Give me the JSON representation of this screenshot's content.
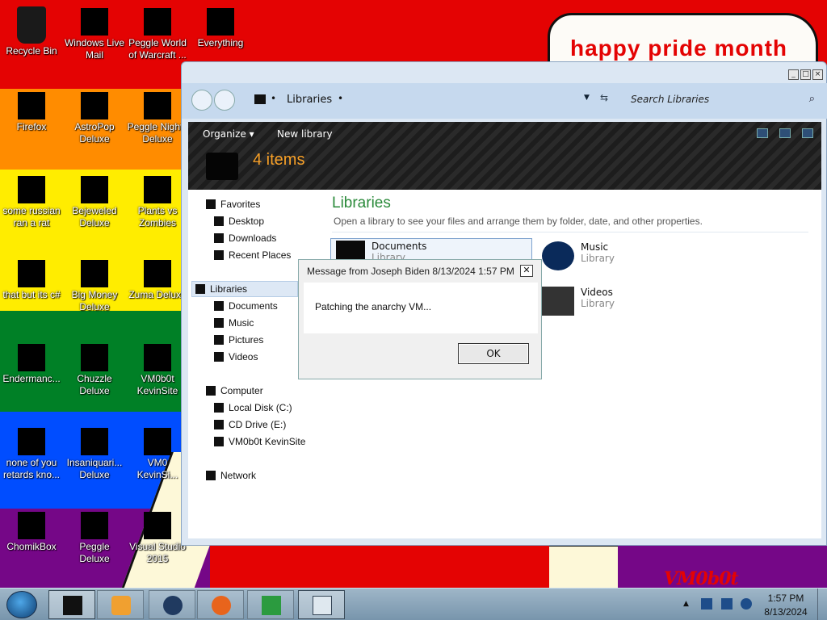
{
  "desktop": {
    "banner": "happy pride month",
    "wallpaper_logo": "VM0b0t",
    "icons": [
      {
        "label": "Recycle Bin",
        "icon": "recycle-bin-icon"
      },
      {
        "label": "Windows Live Mail",
        "icon": "mail-icon"
      },
      {
        "label": "Peggle World of Warcraft ...",
        "icon": "peggle-icon"
      },
      {
        "label": "Everything",
        "icon": "search-icon"
      },
      {
        "label": "Firefox",
        "icon": "firefox-icon"
      },
      {
        "label": "AstroPop Deluxe",
        "icon": "game-icon"
      },
      {
        "label": "Peggle Nights Deluxe",
        "icon": "peggle-icon"
      },
      {
        "label": "some russian ran a rat",
        "icon": "app-icon"
      },
      {
        "label": "Bejeweled Deluxe",
        "icon": "gem-icon"
      },
      {
        "label": "Plants vs Zombies",
        "icon": "plant-icon"
      },
      {
        "label": "that but its c#",
        "icon": "app-icon"
      },
      {
        "label": "Big Money Deluxe",
        "icon": "money-icon"
      },
      {
        "label": "Zuma Deluxe",
        "icon": "zuma-icon"
      },
      {
        "label": "Endermanc...",
        "icon": "app-icon"
      },
      {
        "label": "Chuzzle Deluxe",
        "icon": "chuzzle-icon"
      },
      {
        "label": "VM0b0t KevinSite",
        "icon": "app-icon"
      },
      {
        "label": "none of you retards kno...",
        "icon": "app-icon"
      },
      {
        "label": "Insaniquari... Deluxe",
        "icon": "fish-icon"
      },
      {
        "label": "VM0 KevinSi...",
        "icon": "app-icon"
      },
      {
        "label": "ChomikBox",
        "icon": "chomikbox-icon"
      },
      {
        "label": "Peggle Deluxe",
        "icon": "peggle-icon"
      },
      {
        "label": "Visual Studio 2015",
        "icon": "visual-studio-icon"
      }
    ]
  },
  "explorer": {
    "address": "Libraries",
    "search_placeholder": "Search Libraries",
    "toolbar": {
      "organize": "Organize",
      "new_library": "New library"
    },
    "item_count": "4 items",
    "title": "Libraries",
    "subtitle": "Open a library to see your files and arrange them by folder, date, and other properties.",
    "nav": {
      "favorites": "Favorites",
      "desktop": "Desktop",
      "downloads": "Downloads",
      "recent": "Recent Places",
      "libraries": "Libraries",
      "documents": "Documents",
      "music": "Music",
      "pictures": "Pictures",
      "videos": "Videos",
      "computer": "Computer",
      "local_disk": "Local Disk (C:)",
      "cd_drive": "CD Drive (E:)",
      "vm_site": "VM0b0t KevinSite",
      "network": "Network"
    },
    "libraries": {
      "documents": {
        "name": "Documents",
        "type": "Library"
      },
      "music": {
        "name": "Music",
        "type": "Library"
      },
      "videos": {
        "name": "Videos",
        "type": "Library"
      }
    }
  },
  "dialog": {
    "title": "Message from Joseph Biden 8/13/2024 1:57 PM",
    "message": "Patching the anarchy VM...",
    "ok": "OK",
    "close": "✕"
  },
  "taskbar": {
    "time": "1:57 PM",
    "date": "8/13/2024",
    "apps": [
      "libraries-icon",
      "media-player-icon",
      "network-globe-icon",
      "firefox-icon",
      "download-manager-icon",
      "notepad-icon"
    ]
  }
}
